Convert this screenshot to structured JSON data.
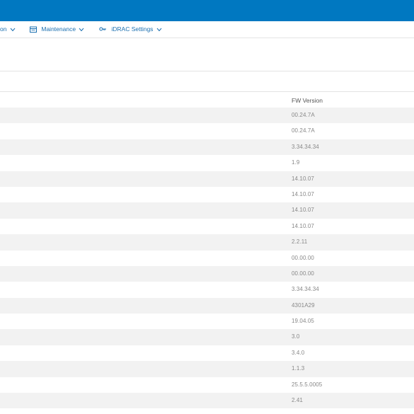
{
  "nav": {
    "items": [
      {
        "label": "on",
        "icon": "chevron-down-icon"
      },
      {
        "label": "Maintenance",
        "icon": "calendar-icon"
      },
      {
        "label": "iDRAC Settings",
        "icon": "key-icon"
      }
    ]
  },
  "colors": {
    "header": "#0078c1",
    "link": "#1a6fb0",
    "stripe": "#f2f2f2"
  },
  "table": {
    "column_header": "FW Version",
    "rows": [
      "00.24.7A",
      "00.24.7A",
      "3.34.34.34",
      "1.9",
      "14.10.07",
      "14.10.07",
      "14.10.07",
      "14.10.07",
      "2.2.11",
      "00.00.00",
      "00.00.00",
      "3.34.34.34",
      "4301A29",
      "19.04.05",
      "3.0",
      "3.4.0",
      "1.1.3",
      "25.5.5.0005",
      "2.41"
    ]
  }
}
